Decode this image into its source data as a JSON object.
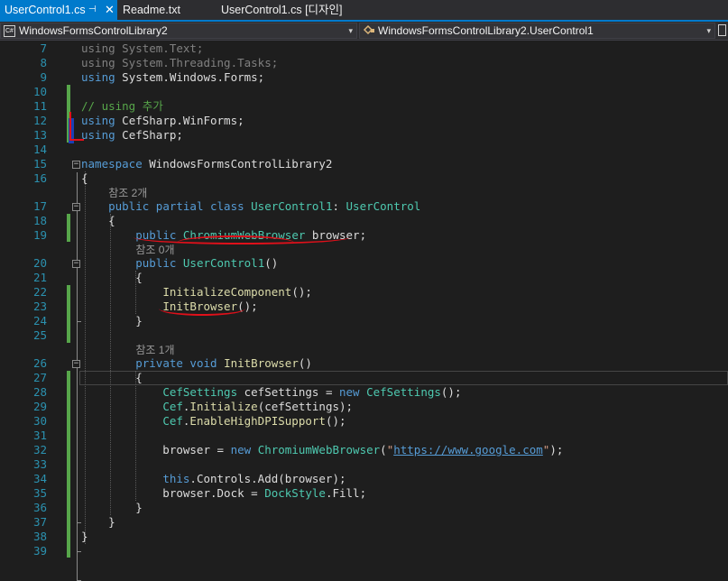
{
  "tabs": [
    {
      "label": "UserControl1.cs",
      "pin": "⊣",
      "close": "✕",
      "active": true
    },
    {
      "label": "Readme.txt",
      "active": false
    },
    {
      "label": "UserControl1.cs [디자인]",
      "active": false
    }
  ],
  "nav": {
    "project_icon": "C#",
    "project": "WindowsFormsControlLibrary2",
    "class_icon": "class-icon",
    "class_name": "WindowsFormsControlLibrary2.UserControl1",
    "dropdown_arrow": "▾"
  },
  "code_lines": [
    {
      "n": "7",
      "parts": [
        {
          "c": "t-dim",
          "t": "using System.Text;"
        }
      ]
    },
    {
      "n": "8",
      "parts": [
        {
          "c": "t-dim",
          "t": "using System.Threading.Tasks;"
        }
      ]
    },
    {
      "n": "9",
      "parts": [
        {
          "c": "t-kw",
          "t": "using"
        },
        {
          "c": "t-plain",
          "t": " System.Windows.Forms;"
        }
      ]
    },
    {
      "n": "10",
      "parts": []
    },
    {
      "n": "11",
      "parts": [
        {
          "c": "t-cm",
          "t": "// using 추가"
        }
      ]
    },
    {
      "n": "12",
      "parts": [
        {
          "c": "t-kw",
          "t": "using"
        },
        {
          "c": "t-plain",
          "t": " CefSharp.WinForms;"
        }
      ]
    },
    {
      "n": "13",
      "parts": [
        {
          "c": "t-kw",
          "t": "using"
        },
        {
          "c": "t-plain",
          "t": " CefSharp;"
        }
      ]
    },
    {
      "n": "14",
      "parts": []
    },
    {
      "n": "15",
      "parts": [
        {
          "c": "t-kw",
          "t": "namespace"
        },
        {
          "c": "t-plain",
          "t": " WindowsFormsControlLibrary2"
        }
      ]
    },
    {
      "n": "16",
      "parts": [
        {
          "c": "t-plain",
          "t": "{"
        }
      ]
    },
    {
      "n": "17",
      "refs": "참조 2개",
      "parts": [
        {
          "c": "t-plain",
          "t": "    "
        },
        {
          "c": "t-kw",
          "t": "public partial class"
        },
        {
          "c": "t-plain",
          "t": " "
        },
        {
          "c": "t-ty",
          "t": "UserControl1"
        },
        {
          "c": "t-plain",
          "t": ": "
        },
        {
          "c": "t-ty",
          "t": "UserControl"
        }
      ]
    },
    {
      "n": "18",
      "parts": [
        {
          "c": "t-plain",
          "t": "    {"
        }
      ]
    },
    {
      "n": "19",
      "parts": [
        {
          "c": "t-plain",
          "t": "        "
        },
        {
          "c": "t-kw",
          "t": "public"
        },
        {
          "c": "t-plain",
          "t": " "
        },
        {
          "c": "t-ty",
          "t": "ChromiumWebBrowser"
        },
        {
          "c": "t-plain",
          "t": " browser;"
        }
      ]
    },
    {
      "n": "20",
      "refs": "참조 0개",
      "parts": [
        {
          "c": "t-plain",
          "t": "        "
        },
        {
          "c": "t-kw",
          "t": "public"
        },
        {
          "c": "t-plain",
          "t": " "
        },
        {
          "c": "t-ty",
          "t": "UserControl1"
        },
        {
          "c": "t-plain",
          "t": "()"
        }
      ]
    },
    {
      "n": "21",
      "parts": [
        {
          "c": "t-plain",
          "t": "        {"
        }
      ]
    },
    {
      "n": "22",
      "parts": [
        {
          "c": "t-plain",
          "t": "            "
        },
        {
          "c": "t-fn",
          "t": "InitializeComponent"
        },
        {
          "c": "t-plain",
          "t": "();"
        }
      ]
    },
    {
      "n": "23",
      "parts": [
        {
          "c": "t-plain",
          "t": "            "
        },
        {
          "c": "t-fn",
          "t": "InitBrowser"
        },
        {
          "c": "t-plain",
          "t": "();"
        }
      ]
    },
    {
      "n": "24",
      "parts": [
        {
          "c": "t-plain",
          "t": "        }"
        }
      ]
    },
    {
      "n": "25",
      "parts": []
    },
    {
      "n": "26",
      "refs": "참조 1개",
      "parts": [
        {
          "c": "t-plain",
          "t": "        "
        },
        {
          "c": "t-kw",
          "t": "private void"
        },
        {
          "c": "t-plain",
          "t": " "
        },
        {
          "c": "t-fn",
          "t": "InitBrowser"
        },
        {
          "c": "t-plain",
          "t": "()"
        }
      ]
    },
    {
      "n": "27",
      "parts": [
        {
          "c": "t-plain",
          "t": "        {"
        }
      ]
    },
    {
      "n": "28",
      "parts": [
        {
          "c": "t-plain",
          "t": "            "
        },
        {
          "c": "t-ty",
          "t": "CefSettings"
        },
        {
          "c": "t-plain",
          "t": " cefSettings = "
        },
        {
          "c": "t-kw",
          "t": "new"
        },
        {
          "c": "t-plain",
          "t": " "
        },
        {
          "c": "t-ty",
          "t": "CefSettings"
        },
        {
          "c": "t-plain",
          "t": "();"
        }
      ]
    },
    {
      "n": "29",
      "parts": [
        {
          "c": "t-plain",
          "t": "            "
        },
        {
          "c": "t-ty",
          "t": "Cef"
        },
        {
          "c": "t-plain",
          "t": "."
        },
        {
          "c": "t-fn",
          "t": "Initialize"
        },
        {
          "c": "t-plain",
          "t": "(cefSettings);"
        }
      ]
    },
    {
      "n": "30",
      "parts": [
        {
          "c": "t-plain",
          "t": "            "
        },
        {
          "c": "t-ty",
          "t": "Cef"
        },
        {
          "c": "t-plain",
          "t": "."
        },
        {
          "c": "t-fn",
          "t": "EnableHighDPISupport"
        },
        {
          "c": "t-plain",
          "t": "();"
        }
      ]
    },
    {
      "n": "31",
      "parts": []
    },
    {
      "n": "32",
      "parts": [
        {
          "c": "t-plain",
          "t": "            browser = "
        },
        {
          "c": "t-kw",
          "t": "new"
        },
        {
          "c": "t-plain",
          "t": " "
        },
        {
          "c": "t-ty",
          "t": "ChromiumWebBrowser"
        },
        {
          "c": "t-plain",
          "t": "("
        },
        {
          "c": "t-str",
          "t": "\""
        },
        {
          "c": "t-url",
          "t": "https://www.google.com"
        },
        {
          "c": "t-str",
          "t": "\""
        },
        {
          "c": "t-plain",
          "t": ");"
        }
      ]
    },
    {
      "n": "33",
      "parts": []
    },
    {
      "n": "34",
      "parts": [
        {
          "c": "t-plain",
          "t": "            "
        },
        {
          "c": "t-kw",
          "t": "this"
        },
        {
          "c": "t-plain",
          "t": ".Controls.Add(browser);"
        }
      ]
    },
    {
      "n": "35",
      "parts": [
        {
          "c": "t-plain",
          "t": "            browser.Dock = "
        },
        {
          "c": "t-ty",
          "t": "DockStyle"
        },
        {
          "c": "t-plain",
          "t": ".Fill;"
        }
      ]
    },
    {
      "n": "36",
      "parts": [
        {
          "c": "t-plain",
          "t": "        }"
        }
      ]
    },
    {
      "n": "37",
      "parts": [
        {
          "c": "t-plain",
          "t": "    }"
        }
      ]
    },
    {
      "n": "38",
      "parts": [
        {
          "c": "t-plain",
          "t": "}"
        }
      ]
    },
    {
      "n": "39",
      "parts": []
    }
  ],
  "fold_glyph": "−"
}
